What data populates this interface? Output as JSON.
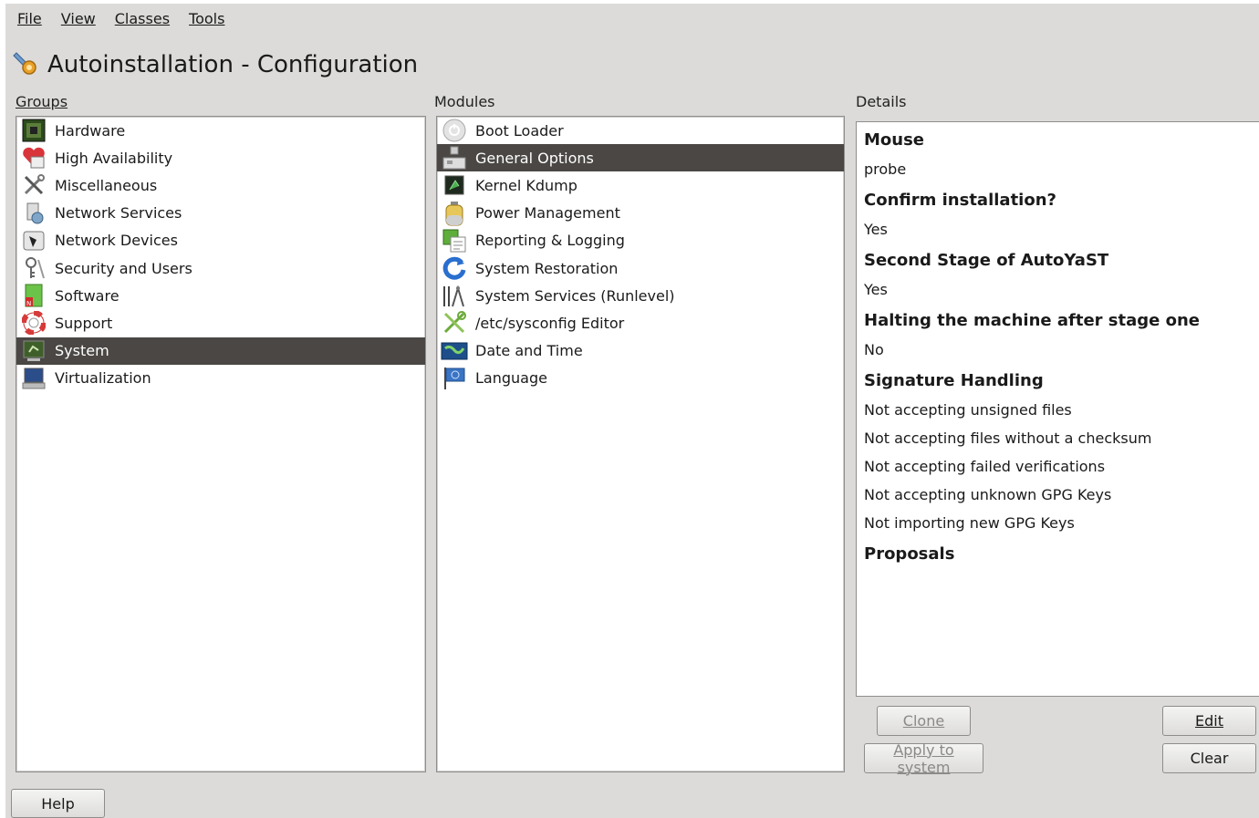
{
  "menu": [
    {
      "label": "File"
    },
    {
      "label": "View"
    },
    {
      "label": "Classes"
    },
    {
      "label": "Tools"
    }
  ],
  "title": "Autoinstallation - Configuration",
  "groups": {
    "label": "Groups",
    "items": [
      {
        "label": "Hardware",
        "icon": "hardware-icon"
      },
      {
        "label": "High Availability",
        "icon": "high-availability-icon"
      },
      {
        "label": "Miscellaneous",
        "icon": "tools-icon"
      },
      {
        "label": "Network Services",
        "icon": "network-services-icon"
      },
      {
        "label": "Network Devices",
        "icon": "network-devices-icon"
      },
      {
        "label": "Security and Users",
        "icon": "security-icon"
      },
      {
        "label": "Software",
        "icon": "software-icon"
      },
      {
        "label": "Support",
        "icon": "lifebuoy-icon"
      },
      {
        "label": "System",
        "icon": "system-icon",
        "selected": true
      },
      {
        "label": "Virtualization",
        "icon": "virtualization-icon"
      }
    ]
  },
  "modules": {
    "label": "Modules",
    "items": [
      {
        "label": "Boot Loader",
        "icon": "boot-loader-icon"
      },
      {
        "label": "General Options",
        "icon": "general-options-icon",
        "selected": true
      },
      {
        "label": "Kernel Kdump",
        "icon": "kdump-icon"
      },
      {
        "label": "Power Management",
        "icon": "power-icon"
      },
      {
        "label": "Reporting & Logging",
        "icon": "reporting-icon"
      },
      {
        "label": "System Restoration",
        "icon": "restore-icon"
      },
      {
        "label": "System Services (Runlevel)",
        "icon": "services-icon"
      },
      {
        "label": "/etc/sysconfig Editor",
        "icon": "sysconfig-icon"
      },
      {
        "label": "Date and Time",
        "icon": "date-time-icon"
      },
      {
        "label": "Language",
        "icon": "language-icon"
      }
    ]
  },
  "details": {
    "label": "Details",
    "sections": [
      {
        "heading": "Mouse",
        "values": [
          "probe"
        ]
      },
      {
        "heading": "Confirm installation?",
        "values": [
          "Yes"
        ]
      },
      {
        "heading": "Second Stage of AutoYaST",
        "values": [
          "Yes"
        ]
      },
      {
        "heading": "Halting the machine after stage one",
        "values": [
          "No"
        ]
      },
      {
        "heading": "Signature Handling",
        "values": [
          "Not accepting unsigned files",
          "Not accepting files without a checksum",
          "Not accepting failed verifications",
          "Not accepting unknown GPG Keys",
          "Not importing new GPG Keys"
        ]
      },
      {
        "heading": "Proposals",
        "values": []
      }
    ]
  },
  "buttons": {
    "clone": "Clone",
    "edit": "Edit",
    "apply": "Apply to system",
    "clear": "Clear",
    "help": "Help"
  },
  "colors": {
    "selection": "#4a4744",
    "window_bg": "#dcdbd9"
  }
}
